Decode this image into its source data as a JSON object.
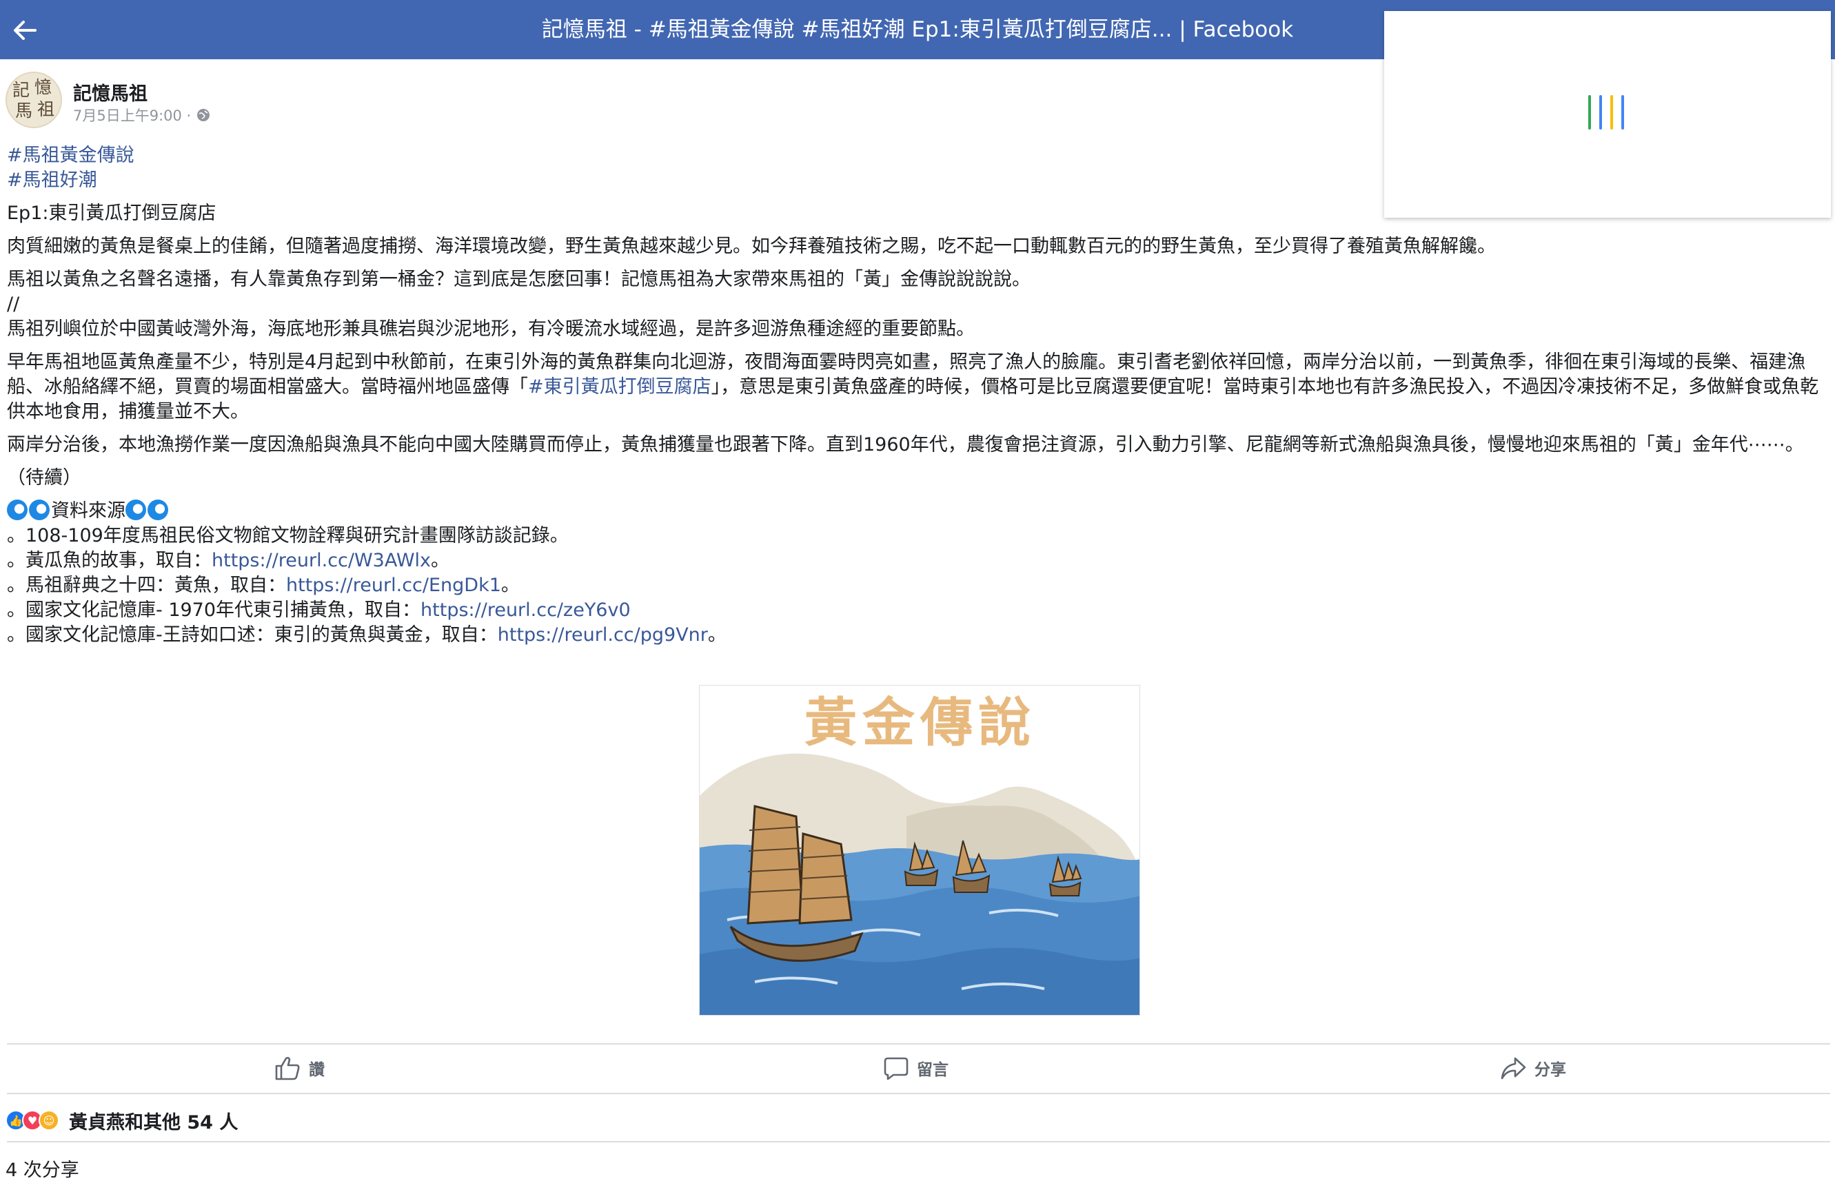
{
  "topbar": {
    "title": "記憶馬祖 - #馬祖黃金傳說 #馬祖好潮 Ep1:東引黃瓜打倒豆腐店... | Facebook",
    "bg_color": "#4267b2",
    "back_icon": "arrow-left-icon"
  },
  "loader": {
    "colors": [
      "#34a853",
      "#4285f4",
      "#fbbc05",
      "#4285f4"
    ]
  },
  "post": {
    "page_name": "記憶馬祖",
    "avatar_text": [
      "記",
      "憶",
      "馬",
      "祖"
    ],
    "timestamp": "7月5日上午9:00 · ",
    "privacy_icon": "globe-icon",
    "hashtags": [
      "#馬祖黃金傳說",
      "#馬祖好潮"
    ],
    "episode_title": "Ep1:東引黃瓜打倒豆腐店",
    "paragraphs": {
      "p1": "肉質細嫩的黃魚是餐桌上的佳餚，但隨著過度捕撈、海洋環境改變，野生黃魚越來越少見。如今拜養殖技術之賜，吃不起一口動輒數百元的的野生黃魚，至少買得了養殖黃魚解解饞。",
      "p2": "馬祖以黃魚之名聲名遠播，有人靠黃魚存到第一桶金？這到底是怎麼回事！記憶馬祖為大家帶來馬祖的「黃」金傳說說說說。",
      "p3_sep": "//",
      "p3": "馬祖列嶼位於中國黃岐灣外海，海底地形兼具礁岩與沙泥地形，有冷暖流水域經過，是許多迴游魚種途經的重要節點。",
      "p4_before": "早年馬祖地區黃魚產量不少，特別是4月起到中秋節前，在東引外海的黃魚群集向北迴游，夜間海面霎時閃亮如晝，照亮了漁人的臉龐。東引耆老劉依祥回憶，兩岸分治以前，一到黃魚季，徘徊在東引海域的長樂、福建漁船、冰船絡繹不絕，買賣的場面相當盛大。當時福州地區盛傳「",
      "p4_link": "#東引黃瓜打倒豆腐店",
      "p4_after": "」，意思是東引黃魚盛產的時候，價格可是比豆腐還要便宜呢！當時東引本地也有許多漁民投入，不過因冷凍技術不足，多做鮮食或魚乾供本地食用，捕獲量並不大。",
      "p5": "兩岸分治後，本地漁撈作業一度因漁船與漁具不能向中國大陸購買而停止，黃魚捕獲量也跟著下降。直到1960年代，農復會挹注資源，引入動力引擎、尼龍網等新式漁船與漁具後，慢慢地迎來馬祖的「黃」金年代⋯⋯。",
      "p6": "（待續）"
    },
    "sources_heading": "資料來源",
    "sources": [
      {
        "text": "。108-109年度馬祖民俗文物館文物詮釋與研究計畫團隊訪談記錄。",
        "url": "",
        "suffix": ""
      },
      {
        "text": "。黃瓜魚的故事，取自：",
        "url": "https://reurl.cc/W3AWlx",
        "suffix": "。"
      },
      {
        "text": "。馬祖辭典之十四：黃魚，取自：",
        "url": "https://reurl.cc/EngDk1",
        "suffix": "。"
      },
      {
        "text": "。國家文化記憶庫- 1970年代東引捕黃魚，取自：",
        "url": "https://reurl.cc/zeY6v0",
        "suffix": ""
      },
      {
        "text": "。國家文化記憶庫-王詩如口述：東引的黃魚與黃金，取自：",
        "url": "https://reurl.cc/pg9Vnr",
        "suffix": "。"
      }
    ],
    "image": {
      "title_text": "黃金傳說",
      "title_color": "#e8b97e"
    }
  },
  "actions": {
    "like": "讚",
    "comment": "留言",
    "share": "分享"
  },
  "reactions": {
    "summary": "黃貞燕和其他 54 人",
    "types": [
      "like",
      "love",
      "care"
    ]
  },
  "shares": "4 次分享"
}
